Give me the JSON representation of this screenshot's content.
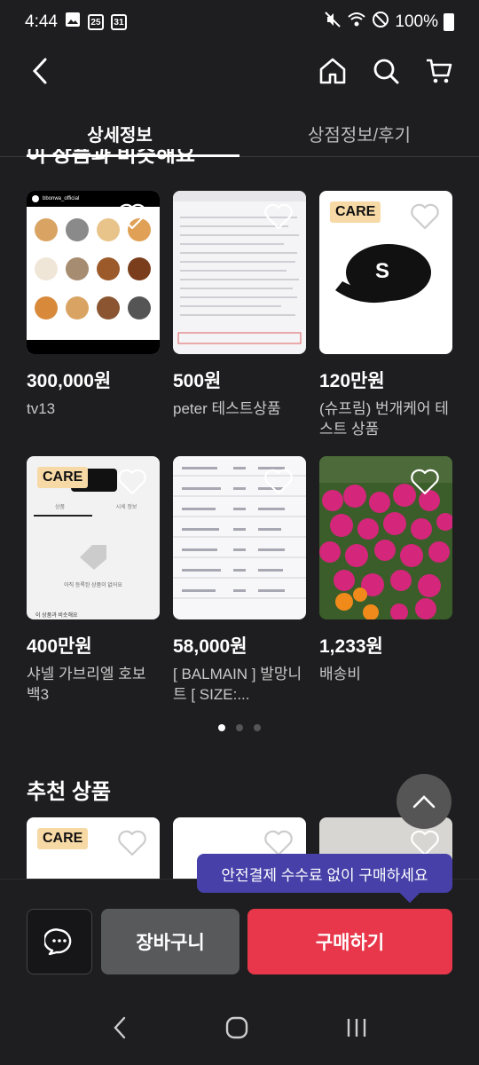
{
  "status_bar": {
    "time": "4:44",
    "date_icon_1": "25",
    "date_icon_2": "31",
    "battery": "100%"
  },
  "tabs": [
    {
      "label": "상세정보",
      "active": true
    },
    {
      "label": "상점정보/후기",
      "active": false
    }
  ],
  "similar_section": {
    "title": "이 상품과 비슷해요"
  },
  "products": [
    {
      "price": "300,000원",
      "name": "tv13",
      "thumb": "instagram-dogs",
      "account": "bbonwa_official"
    },
    {
      "price": "500원",
      "name": "peter 테스트상품",
      "thumb": "code-screenshot"
    },
    {
      "price": "120만원",
      "name": "(슈프림) 번개케어 테스트 상품",
      "thumb": "cap",
      "badge": "CARE"
    },
    {
      "price": "400만원",
      "name": "샤넬 가브리엘 호보백3",
      "thumb": "empty-shop",
      "badge": "CARE",
      "inner_tabs": [
        "상품",
        "시세 정보"
      ],
      "empty_text": "아직 등록된 상품이 없어요",
      "bottom_text": "이 상품과 비슷해요"
    },
    {
      "price": "58,000원",
      "name": "[ BALMAIN ] 발망니트 [ SIZE:...",
      "thumb": "table-list"
    },
    {
      "price": "1,233원",
      "name": "배송비",
      "thumb": "flowers"
    }
  ],
  "pagination": {
    "pages": 3,
    "current": 0
  },
  "recommended": {
    "title": "추천 상품",
    "items": [
      {
        "badge": "CARE"
      },
      {
        "badge": ""
      },
      {
        "badge": ""
      }
    ]
  },
  "tooltip": "안전결제 수수료 없이 구매하세요",
  "bottom_bar": {
    "cart_label": "장바구니",
    "buy_label": "구매하기"
  },
  "colors": {
    "buy": "#e8374a",
    "tooltip": "#4640a8",
    "care_badge": "#f7d9a6"
  }
}
